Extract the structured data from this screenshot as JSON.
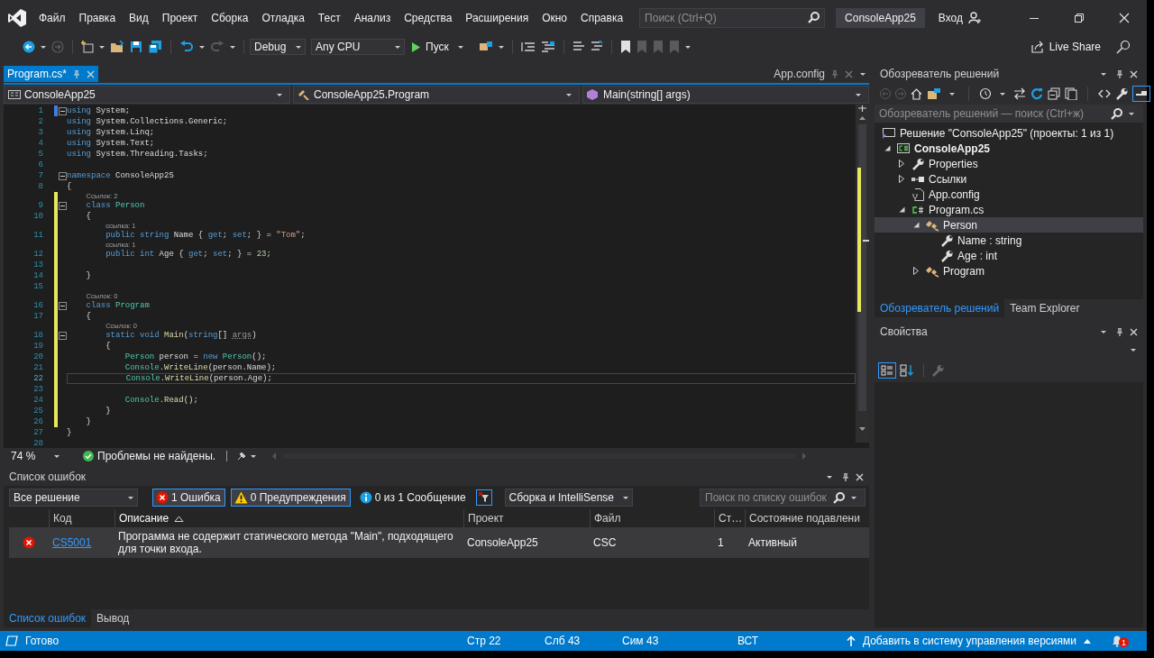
{
  "window": {
    "title": "ConsoleApp25"
  },
  "menu": [
    "Файл",
    "Правка",
    "Вид",
    "Проект",
    "Сборка",
    "Отладка",
    "Тест",
    "Анализ",
    "Средства",
    "Расширения",
    "Окно",
    "Справка"
  ],
  "search": {
    "placeholder": "Поиск (Ctrl+Q)"
  },
  "account": {
    "label": "Вход"
  },
  "toolbar": {
    "configuration": "Debug",
    "platform": "Any CPU",
    "start": "Пуск",
    "live_share": "Live Share"
  },
  "editor": {
    "tabs": [
      {
        "label": "Program.cs*",
        "selected": true
      },
      {
        "label": "App.config",
        "selected": false
      }
    ],
    "navigation": [
      "ConsoleApp25",
      "ConsoleApp25.Program",
      "Main(string[] args)"
    ],
    "lines": [
      {
        "number": "1",
        "changed": true,
        "saved": true,
        "expanded": true,
        "current": false,
        "tokens": [
          {
            "text": "using",
            "kind": "keyword"
          },
          {
            "text": " System;",
            "kind": "plain"
          }
        ]
      },
      {
        "number": "2",
        "changed": false,
        "current": false,
        "tokens": [
          {
            "text": "using",
            "kind": "keyword"
          },
          {
            "text": " System.Collections.Generic;",
            "kind": "plain"
          }
        ]
      },
      {
        "number": "3",
        "changed": false,
        "current": false,
        "tokens": [
          {
            "text": "using",
            "kind": "keyword"
          },
          {
            "text": " System.Linq;",
            "kind": "plain"
          }
        ]
      },
      {
        "number": "4",
        "changed": false,
        "current": false,
        "tokens": [
          {
            "text": "using",
            "kind": "keyword"
          },
          {
            "text": " System.Text;",
            "kind": "plain"
          }
        ]
      },
      {
        "number": "5",
        "changed": false,
        "current": false,
        "tokens": [
          {
            "text": "using",
            "kind": "keyword"
          },
          {
            "text": " System.Threading.Tasks;",
            "kind": "plain"
          }
        ]
      },
      {
        "number": "6",
        "changed": false,
        "current": false
      },
      {
        "number": "7",
        "changed": false,
        "expanded": true,
        "current": false,
        "tokens": [
          {
            "text": "namespace",
            "kind": "keyword"
          },
          {
            "text": " ConsoleApp25",
            "kind": "plain"
          }
        ]
      },
      {
        "number": "8",
        "changed": false,
        "current": false,
        "tokens": [
          {
            "text": "{",
            "kind": "plain"
          }
        ]
      },
      {
        "number": "9",
        "changed": true,
        "saved": false,
        "expanded": true,
        "current": false,
        "codelens": "Ссылок: 2",
        "tokens": [
          {
            "text": "    class",
            "kind": "keyword"
          },
          {
            "text": " Person",
            "kind": "type"
          }
        ]
      },
      {
        "number": "10",
        "changed": true,
        "saved": false,
        "current": false,
        "tokens": [
          {
            "text": "    {",
            "kind": "plain"
          }
        ]
      },
      {
        "number": "11",
        "changed": true,
        "saved": false,
        "current": false,
        "codelens": "ссылка: 1",
        "tokens": [
          {
            "text": "        public string",
            "kind": "keyword"
          },
          {
            "text": " Name { ",
            "kind": "plain"
          },
          {
            "text": "get",
            "kind": "keyword"
          },
          {
            "text": "; ",
            "kind": "plain"
          },
          {
            "text": "set",
            "kind": "keyword"
          },
          {
            "text": "; } = ",
            "kind": "plain"
          },
          {
            "text": "\"Tom\"",
            "kind": "string"
          },
          {
            "text": ";",
            "kind": "plain"
          }
        ]
      },
      {
        "number": "12",
        "changed": true,
        "saved": false,
        "current": false,
        "codelens": "ссылка: 1",
        "tokens": [
          {
            "text": "        public int",
            "kind": "keyword"
          },
          {
            "text": " Age { ",
            "kind": "plain"
          },
          {
            "text": "get",
            "kind": "keyword"
          },
          {
            "text": "; ",
            "kind": "plain"
          },
          {
            "text": "set",
            "kind": "keyword"
          },
          {
            "text": "; } = ",
            "kind": "plain"
          },
          {
            "text": "23",
            "kind": "number"
          },
          {
            "text": ";",
            "kind": "plain"
          }
        ]
      },
      {
        "number": "13",
        "changed": true,
        "saved": false,
        "current": false
      },
      {
        "number": "14",
        "changed": true,
        "saved": false,
        "current": false,
        "tokens": [
          {
            "text": "    }",
            "kind": "plain"
          }
        ]
      },
      {
        "number": "15",
        "changed": true,
        "saved": false,
        "current": false
      },
      {
        "number": "16",
        "changed": true,
        "saved": false,
        "expanded": true,
        "current": false,
        "codelens": "Ссылок: 0",
        "tokens": [
          {
            "text": "    class",
            "kind": "keyword"
          },
          {
            "text": " Program",
            "kind": "type"
          }
        ]
      },
      {
        "number": "17",
        "changed": true,
        "saved": false,
        "current": false,
        "tokens": [
          {
            "text": "    {",
            "kind": "plain"
          }
        ]
      },
      {
        "number": "18",
        "changed": true,
        "saved": false,
        "expanded": true,
        "current": false,
        "codelens": "Ссылок: 0",
        "tokens": [
          {
            "text": "        static void",
            "kind": "keyword"
          },
          {
            "text": " Main",
            "kind": "method"
          },
          {
            "text": "(",
            "kind": "plain"
          },
          {
            "text": "string",
            "kind": "keyword"
          },
          {
            "text": "[] ",
            "kind": "plain"
          },
          {
            "text": "args",
            "kind": "unused"
          },
          {
            "text": ")",
            "kind": "plain"
          }
        ]
      },
      {
        "number": "19",
        "changed": true,
        "saved": false,
        "current": false,
        "tokens": [
          {
            "text": "        {",
            "kind": "plain"
          }
        ]
      },
      {
        "number": "20",
        "changed": true,
        "saved": false,
        "current": false,
        "tokens": [
          {
            "text": "            Person",
            "kind": "type"
          },
          {
            "text": " person = ",
            "kind": "plain"
          },
          {
            "text": "new",
            "kind": "keyword"
          },
          {
            "text": " Person",
            "kind": "type"
          },
          {
            "text": "();",
            "kind": "plain"
          }
        ]
      },
      {
        "number": "21",
        "changed": true,
        "saved": false,
        "current": false,
        "tokens": [
          {
            "text": "            Console",
            "kind": "type"
          },
          {
            "text": ".",
            "kind": "plain"
          },
          {
            "text": "WriteLine",
            "kind": "method"
          },
          {
            "text": "(person.Name);",
            "kind": "plain"
          }
        ]
      },
      {
        "number": "22",
        "changed": true,
        "saved": false,
        "current": true,
        "tokens": [
          {
            "text": "            Console",
            "kind": "type"
          },
          {
            "text": ".",
            "kind": "plain"
          },
          {
            "text": "WriteLine",
            "kind": "method"
          },
          {
            "text": "(person.Age);",
            "kind": "plain"
          }
        ]
      },
      {
        "number": "23",
        "changed": true,
        "saved": false,
        "current": false
      },
      {
        "number": "24",
        "changed": true,
        "saved": false,
        "current": false,
        "tokens": [
          {
            "text": "            Console",
            "kind": "type"
          },
          {
            "text": ".",
            "kind": "plain"
          },
          {
            "text": "Read",
            "kind": "method"
          },
          {
            "text": "();",
            "kind": "plain"
          }
        ]
      },
      {
        "number": "25",
        "changed": true,
        "saved": false,
        "current": false,
        "tokens": [
          {
            "text": "        }",
            "kind": "plain"
          }
        ]
      },
      {
        "number": "26",
        "changed": true,
        "saved": false,
        "current": false,
        "tokens": [
          {
            "text": "    }",
            "kind": "plain"
          }
        ]
      },
      {
        "number": "27",
        "changed": false,
        "current": false,
        "tokens": [
          {
            "text": "}",
            "kind": "plain"
          }
        ]
      },
      {
        "number": "28",
        "changed": false,
        "current": false
      }
    ],
    "zoom": "74 %",
    "health": "Проблемы не найдены."
  },
  "error_list": {
    "title": "Список ошибок",
    "scope": "Все решение",
    "filters": [
      {
        "kind": "error",
        "label": "1 Ошибка",
        "selected": true
      },
      {
        "kind": "warning",
        "label": "0 Предупреждения",
        "selected": true
      },
      {
        "kind": "info",
        "label": "0 из 1 Сообщение",
        "selected": false
      }
    ],
    "filter_active": true,
    "source": "Сборка и IntelliSense",
    "search": {
      "placeholder": "Поиск по списку ошибок"
    },
    "columns": [
      {
        "label": "Код",
        "sorted": false
      },
      {
        "label": "Описание",
        "sorted": true
      },
      {
        "label": "Проект",
        "sorted": false
      },
      {
        "label": "Файл",
        "sorted": false
      },
      {
        "label": "Ст…",
        "sorted": false
      },
      {
        "label": "Состояние подавлени",
        "sorted": false
      }
    ],
    "rows": [
      {
        "kind": "error",
        "selected": true,
        "code": "CS5001",
        "description": "Программа не содержит статического метода \"Main\", подходящего для точки входа.",
        "project": "ConsoleApp25",
        "file": "CSC",
        "line": "1",
        "suppression_state": "Активный"
      }
    ],
    "tabs": [
      {
        "label": "Список ошибок",
        "selected": true
      },
      {
        "label": "Вывод",
        "selected": false
      }
    ]
  },
  "solution_explorer": {
    "title": "Обозреватель решений",
    "preview_selected": true,
    "search": {
      "placeholder": "Обозреватель решений — поиск (Ctrl+ж)"
    },
    "tree": [
      {
        "kind": "solution",
        "label": "Решение \"ConsoleApp25\" (проекты: 1 из 1)",
        "selected": false,
        "children": [
          {
            "kind": "project",
            "label": "ConsoleApp25",
            "expanded": true,
            "selected": false,
            "children": [
              {
                "kind": "properties",
                "label": "Properties",
                "expanded": false,
                "selected": false
              },
              {
                "kind": "references",
                "label": "Ссылки",
                "expanded": false,
                "selected": false
              },
              {
                "kind": "config",
                "label": "App.config",
                "selected": false
              },
              {
                "kind": "csfile",
                "label": "Program.cs",
                "expanded": true,
                "selected": false,
                "children": [
                  {
                    "kind": "class",
                    "label": "Person",
                    "expanded": true,
                    "selected": true,
                    "children": [
                      {
                        "kind": "property",
                        "label": "Name : string",
                        "selected": false
                      },
                      {
                        "kind": "property",
                        "label": "Age : int",
                        "selected": false
                      }
                    ]
                  },
                  {
                    "kind": "class",
                    "label": "Program",
                    "expanded": false,
                    "selected": false
                  }
                ]
              }
            ]
          }
        ]
      }
    ],
    "tabs": [
      {
        "label": "Обозреватель решений",
        "selected": true
      },
      {
        "label": "Team Explorer",
        "selected": false
      }
    ]
  },
  "properties": {
    "title": "Свойства",
    "categorized": true
  },
  "status_bar": {
    "state": "Готово",
    "line": "Стр 22",
    "column": "Слб 43",
    "char": "Сим 43",
    "mode": "ВСТ",
    "source_control": "Добавить в систему управления версиями",
    "notifications": "1"
  }
}
